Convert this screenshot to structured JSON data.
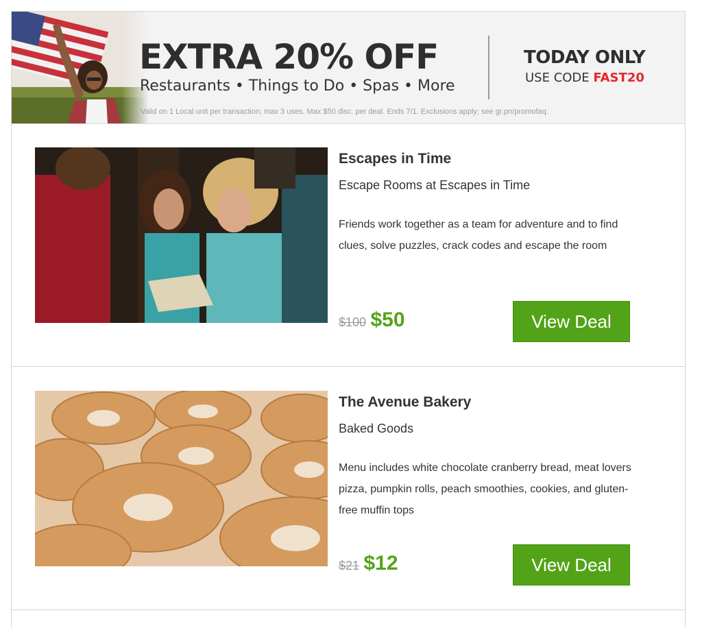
{
  "banner": {
    "headline": "EXTRA 20% OFF",
    "categories": "Restaurants • Things to Do • Spas • More",
    "today_only": "TODAY ONLY",
    "use_code_label": "USE CODE ",
    "code": "FAST20",
    "fine_print": "Valid on 1 Local unit per transaction; max 3 uses. Max $50 disc. per deal. Ends 7/1. Exclusions apply; see gr.pn/promofaq."
  },
  "deals": [
    {
      "title": "Escapes in Time",
      "subtitle": "Escape Rooms at Escapes in Time",
      "description": "Friends work together as a team for adventure and to find clues, solve puzzles, crack codes and escape the room",
      "old_price": "$100",
      "new_price": "$50",
      "button_label": "View Deal"
    },
    {
      "title": "The Avenue Bakery",
      "subtitle": "Baked Goods",
      "description": "Menu includes white chocolate cranberry bread, meat lovers pizza, pumpkin rolls, peach smoothies, cookies, and gluten-free muffin tops",
      "old_price": "$21",
      "new_price": "$12",
      "button_label": "View Deal"
    }
  ],
  "colors": {
    "accent_green": "#53a318",
    "code_red": "#e8262c"
  }
}
